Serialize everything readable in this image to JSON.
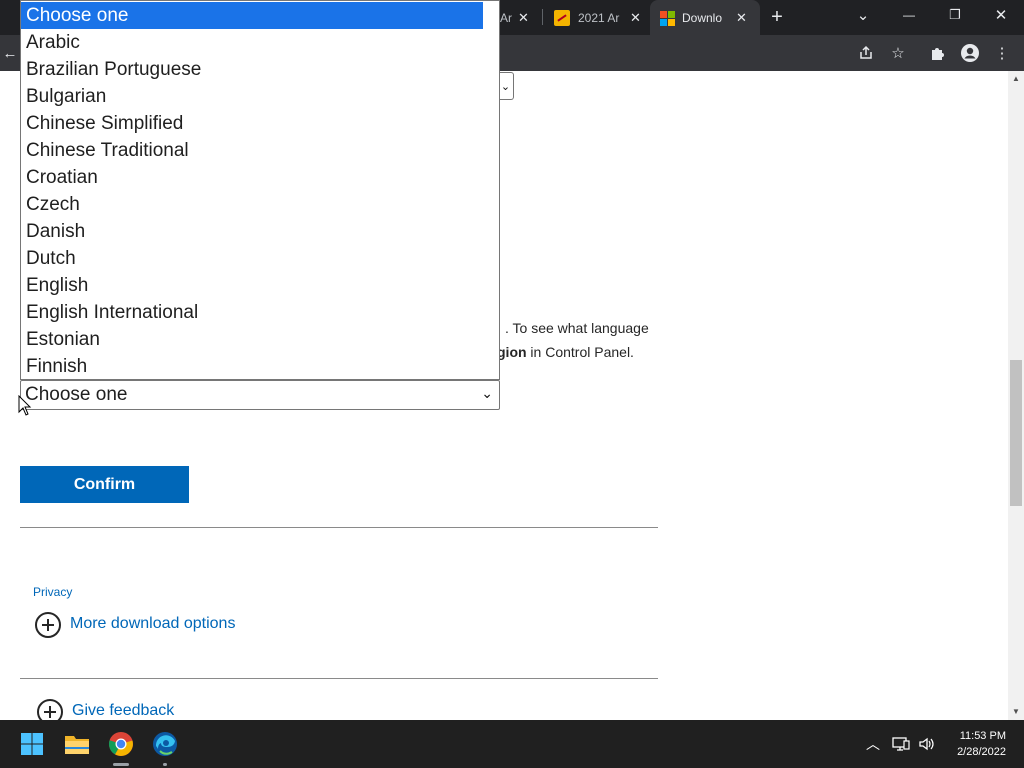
{
  "browser": {
    "tabs": [
      {
        "label": "Ar",
        "close": "✕"
      },
      {
        "label": "2021 Ar",
        "close": "✕"
      },
      {
        "label": "Downlo",
        "close": "✕"
      }
    ],
    "new_tab_label": "+",
    "window_controls": {
      "tab_search": "⌄",
      "minimize": "—",
      "restore": "❐",
      "close": "✕"
    },
    "toolbar_icons": [
      "share-icon",
      "star-icon",
      "extensions-icon",
      "profile-icon",
      "menu-icon"
    ]
  },
  "page": {
    "text_line1": ". To see what language",
    "text_line2_bold": "gion",
    "text_line2_rest": " in Control Panel.",
    "language_select": {
      "value": "Choose one"
    },
    "confirm_label": "Confirm",
    "privacy_link": "Privacy",
    "more_download_options": "More download options",
    "give_feedback": "Give feedback"
  },
  "dropdown": {
    "options": [
      "Choose one",
      "Arabic",
      "Brazilian Portuguese",
      "Bulgarian",
      "Chinese Simplified",
      "Chinese Traditional",
      "Croatian",
      "Czech",
      "Danish",
      "Dutch",
      "English",
      "English International",
      "Estonian",
      "Finnish"
    ],
    "selected_index": 0
  },
  "taskbar": {
    "icons": [
      "windows-start-icon",
      "file-explorer-icon",
      "chrome-icon",
      "edge-icon"
    ],
    "tray_icons": [
      "chevron-up-icon",
      "network-icon",
      "volume-icon"
    ],
    "time": "11:53 PM",
    "date": "2/28/2022"
  },
  "colors": {
    "accent": "#0067b8",
    "selection": "#1a73e8",
    "chrome_dark": "#202124"
  }
}
